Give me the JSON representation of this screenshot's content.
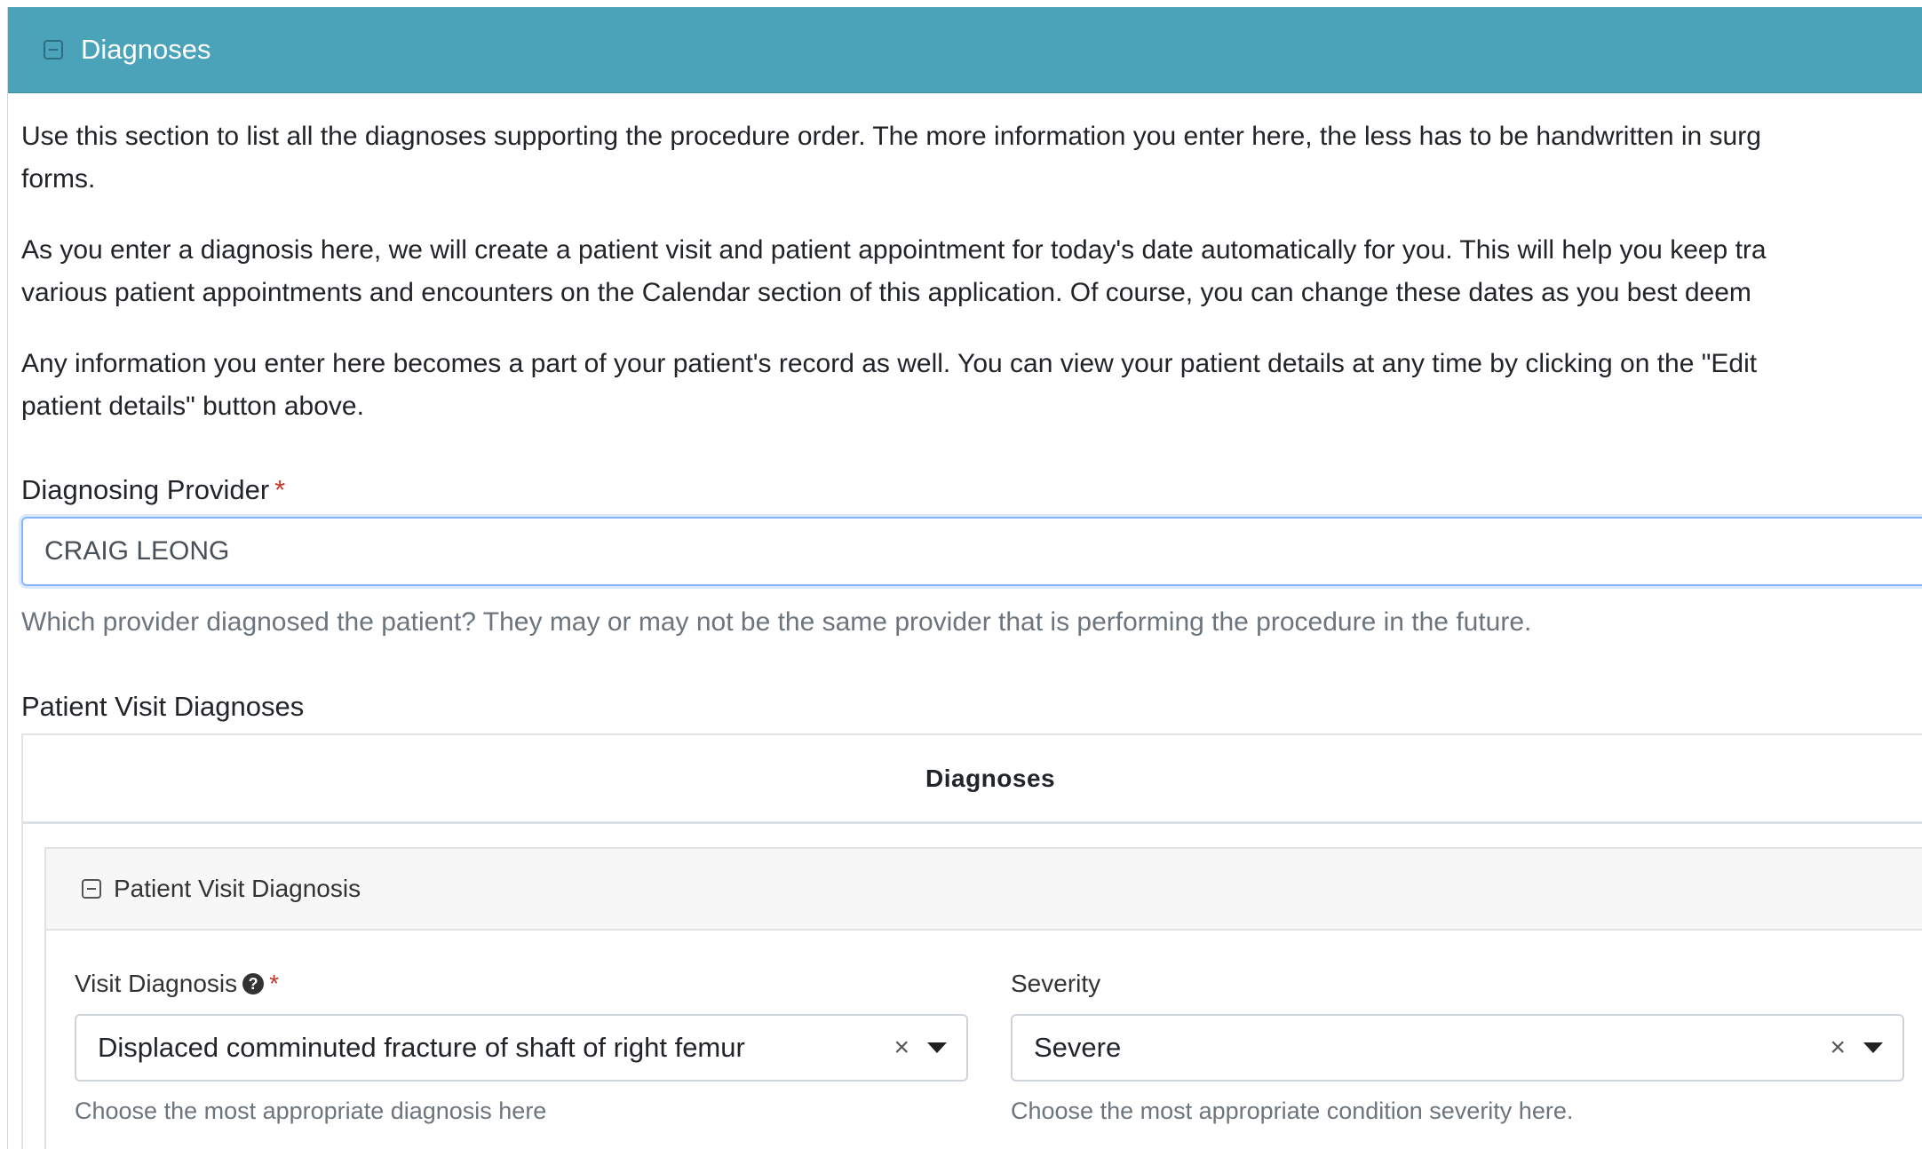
{
  "section": {
    "title": "Diagnoses"
  },
  "intro": {
    "p1_line1": "Use this section to list all the diagnoses supporting the procedure order. The more information you enter here, the less has to be handwritten in surg",
    "p1_line2": "forms.",
    "p2_line1": "As you enter a diagnosis here, we will create a patient visit and patient appointment for today's date automatically for you. This will help you keep tra",
    "p2_line2": "various patient appointments and encounters on the Calendar section of this application. Of course, you can change these dates as you best deem",
    "p3_line1": "Any information you enter here becomes a part of your patient's record as well. You can view your patient details at any time by clicking on the \"Edit",
    "p3_line2": "patient details\" button above."
  },
  "provider": {
    "label": "Diagnosing Provider",
    "required_mark": "*",
    "value": "CRAIG LEONG",
    "help": "Which provider diagnosed the patient? They may or may not be the same provider that is performing the procedure in the future."
  },
  "visit_diagnoses": {
    "label": "Patient Visit Diagnoses",
    "table_header": "Diagnoses",
    "card_title": "Patient Visit Diagnosis",
    "visit_diagnosis": {
      "label": "Visit Diagnosis",
      "help_icon": "?",
      "required_mark": "*",
      "value": "Displaced comminuted fracture of shaft of right femur",
      "clear": "×",
      "help": "Choose the most appropriate diagnosis here"
    },
    "severity": {
      "label": "Severity",
      "value": "Severe",
      "clear": "×",
      "help": "Choose the most appropriate condition severity here."
    }
  },
  "colors": {
    "header_bg": "#4ba3ba",
    "focus_border": "#86b7fe",
    "required": "#c0392b"
  }
}
